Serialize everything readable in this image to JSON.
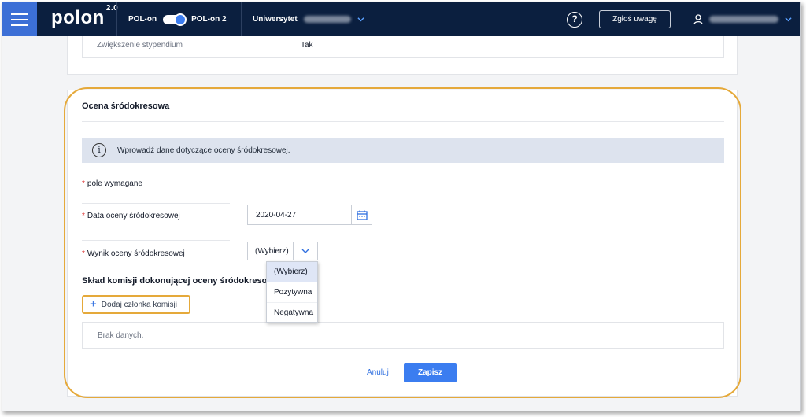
{
  "header": {
    "logo": "polon",
    "logo_version": "2.0",
    "toggle_left": "POL-on",
    "toggle_right": "POL-on 2",
    "university_label": "Uniwersytet",
    "report_button": "Zgłoś uwagę",
    "help_symbol": "?",
    "accent_color": "#3c6fd6",
    "bar_color": "#0b1f3f"
  },
  "top_card": {
    "label": "Zwiększenie stypendium",
    "value": "Tak"
  },
  "section": {
    "title": "Ocena śródokresowa",
    "info_text": "Wprowadź dane dotyczące oceny śródokresowej.",
    "required_note": "pole wymagane",
    "required_mark": "*",
    "date_label": "Data oceny śródokresowej",
    "date_value": "2020-04-27",
    "result_label": "Wynik oceny śródokresowej",
    "result_selected": "(Wybierz)",
    "result_options": [
      "(Wybierz)",
      "Pozytywna",
      "Negatywna"
    ],
    "commission_title": "Skład komisji dokonującej oceny śródokresowej",
    "add_member_button": "Dodaj członka komisji",
    "empty_text": "Brak danych.",
    "cancel_button": "Anuluj",
    "save_button": "Zapisz"
  }
}
